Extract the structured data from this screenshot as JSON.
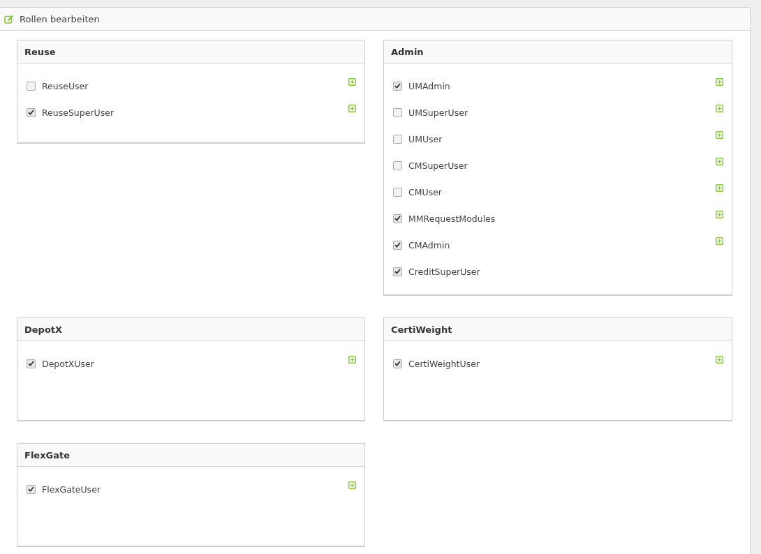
{
  "panel": {
    "title": "Rollen bearbeiten"
  },
  "groups": [
    {
      "name": "Reuse",
      "roles": [
        {
          "label": "ReuseUser",
          "checked": false,
          "expandable": true
        },
        {
          "label": "ReuseSuperUser",
          "checked": true,
          "expandable": true
        }
      ]
    },
    {
      "name": "Admin",
      "roles": [
        {
          "label": "UMAdmin",
          "checked": true,
          "expandable": true
        },
        {
          "label": "UMSuperUser",
          "checked": false,
          "expandable": true
        },
        {
          "label": "UMUser",
          "checked": false,
          "expandable": true
        },
        {
          "label": "CMSuperUser",
          "checked": false,
          "expandable": true
        },
        {
          "label": "CMUser",
          "checked": false,
          "expandable": true
        },
        {
          "label": "MMRequestModules",
          "checked": true,
          "expandable": true
        },
        {
          "label": "CMAdmin",
          "checked": true,
          "expandable": true
        },
        {
          "label": "CreditSuperUser",
          "checked": true,
          "expandable": false
        }
      ]
    },
    {
      "name": "DepotX",
      "roles": [
        {
          "label": "DepotXUser",
          "checked": true,
          "expandable": true
        }
      ]
    },
    {
      "name": "CertiWeight",
      "roles": [
        {
          "label": "CertiWeightUser",
          "checked": true,
          "expandable": true
        }
      ]
    },
    {
      "name": "FlexGate",
      "roles": [
        {
          "label": "FlexGateUser",
          "checked": true,
          "expandable": true
        }
      ]
    }
  ]
}
